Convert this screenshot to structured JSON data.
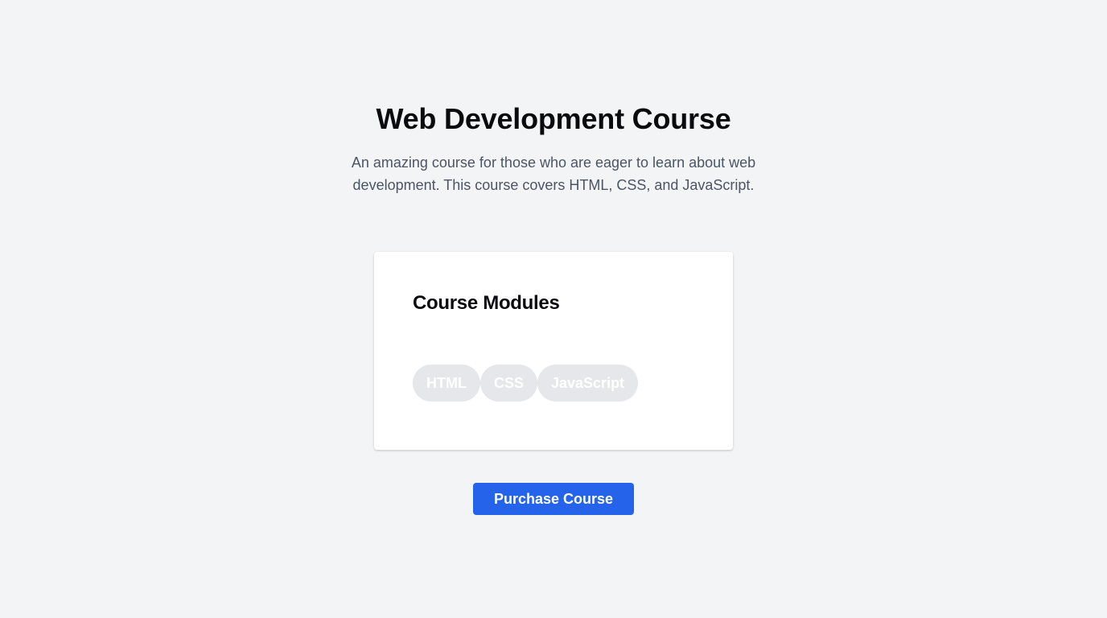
{
  "header": {
    "title": "Web Development Course",
    "description": "An amazing course for those who are eager to learn about web development. This course covers HTML, CSS, and JavaScript."
  },
  "modules_card": {
    "heading": "Course Modules",
    "modules": [
      {
        "label": "HTML"
      },
      {
        "label": "CSS"
      },
      {
        "label": "JavaScript"
      }
    ]
  },
  "actions": {
    "purchase_label": "Purchase Course"
  },
  "colors": {
    "background": "#f3f4f6",
    "card": "#ffffff",
    "pill_background": "#e5e7eb",
    "pill_text": "#ffffff",
    "primary": "#2563eb",
    "title_text": "#0b0b0f",
    "description_text": "#4b5563"
  }
}
